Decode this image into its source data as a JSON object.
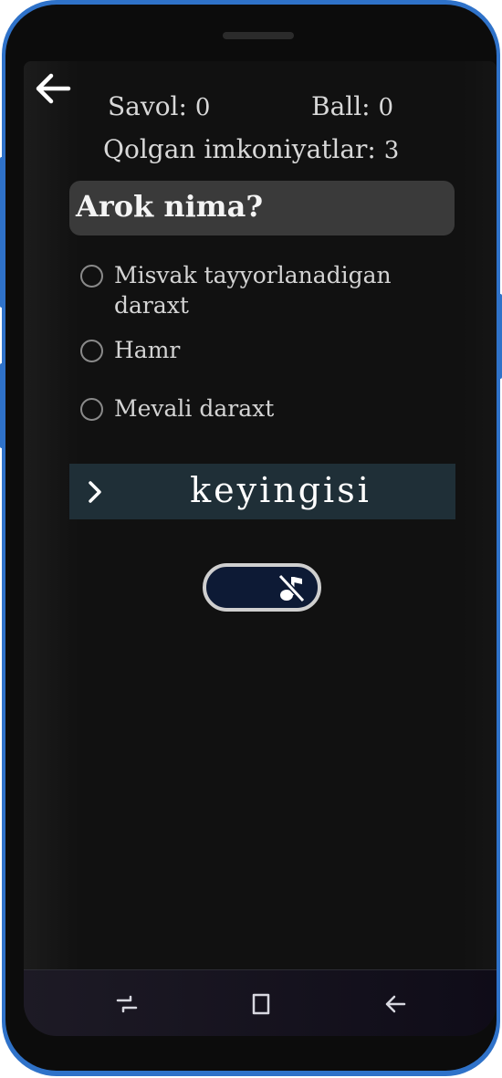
{
  "header": {
    "back_icon": "arrow-left-icon",
    "savol_label": "Savol:",
    "savol_value": "0",
    "ball_label": "Ball:",
    "ball_value": "0",
    "attempts_label": "Qolgan imkoniyatlar:",
    "attempts_value": "3"
  },
  "question": {
    "text": "Arok nima?"
  },
  "options": [
    {
      "label": "Misvak tayyorlanadigan daraxt",
      "selected": false
    },
    {
      "label": "Hamr",
      "selected": false
    },
    {
      "label": "Mevali daraxt",
      "selected": false
    }
  ],
  "next_button": {
    "label": "keyingisi",
    "icon": "chevron-right-icon"
  },
  "sound_toggle": {
    "icon": "music-off-icon",
    "state": "off"
  },
  "navbar": {
    "recents_icon": "recents-icon",
    "home_icon": "home-icon",
    "back_icon": "back-icon"
  },
  "colors": {
    "background": "#111111",
    "question_box": "#3a3a3a",
    "next_button": "#1f2f37",
    "toggle_fill": "#0d1a35",
    "phone_frame": "#2f72c9"
  }
}
